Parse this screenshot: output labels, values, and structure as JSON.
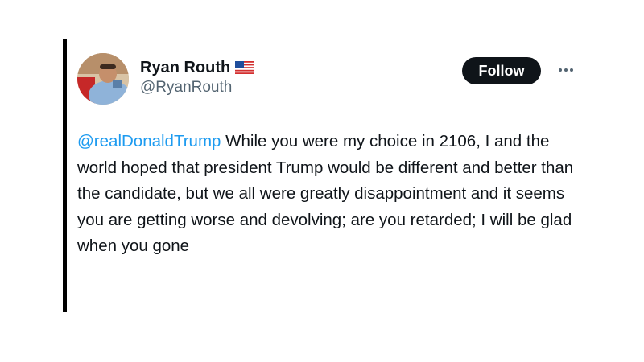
{
  "tweet": {
    "author": {
      "display_name": "Ryan Routh",
      "handle": "@RyanRouth",
      "flag_icon": "us-flag-icon",
      "avatar_icon": "avatar-photo"
    },
    "follow_label": "Follow",
    "more_icon": "more-options-icon",
    "mention": "@realDonaldTrump",
    "body": " While you were my choice in 2106, I and the world hoped that president Trump would be different and better than the candidate, but we all were greatly disappointment and it seems you are getting worse and devolving; are you retarded; I will be glad when you gone"
  },
  "colors": {
    "link": "#1d9bf0",
    "text": "#0f1419",
    "secondary": "#536471",
    "button_bg": "#0f1419",
    "button_text": "#ffffff"
  }
}
